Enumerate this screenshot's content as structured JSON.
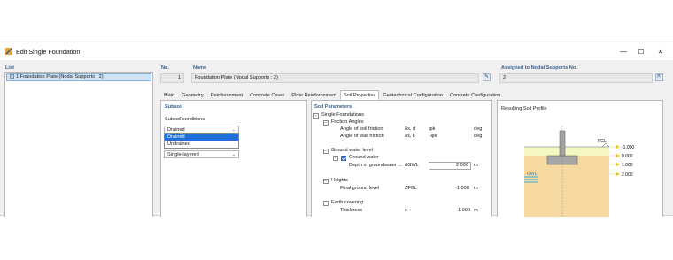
{
  "window": {
    "title": "Edit Single Foundation",
    "controls": {
      "minimize": "—",
      "maximize": "☐",
      "close": "✕"
    }
  },
  "list": {
    "header": "List",
    "items": [
      {
        "label": "1  Foundation Plate (Nodal Supports : 2)"
      }
    ]
  },
  "header": {
    "no_label": "No.",
    "no_value": "1",
    "name_label": "Name",
    "name_value": "Foundation Plate (Nodal Supports : 2)",
    "assigned_label": "Assigned to Nodal Supports No.",
    "assigned_value": "2"
  },
  "tabs": [
    "Main",
    "Geometry",
    "Reinforcement",
    "Concrete Cover",
    "Plate Reinforcement",
    "Soil Properties",
    "Geotechnical Configuration",
    "Concrete Configuration"
  ],
  "active_tab": "Soil Properties",
  "subsoil": {
    "header": "Subsoil",
    "conditions_label": "Subsoil conditions",
    "selected": "Drained",
    "options": [
      "Drained",
      "Undrained"
    ],
    "layering_value": "Single-layered"
  },
  "soil_params": {
    "header": "Soil Parameters",
    "root": "Single Foundations",
    "friction_group": "Friction Angles",
    "rows_friction": [
      {
        "label": "Angle of soil friction",
        "symbol": "δs, d",
        "value": "φk",
        "unit": "deg"
      },
      {
        "label": "Angle of wall friction",
        "symbol": "δs, k",
        "value": "-φk",
        "unit": "deg"
      }
    ],
    "gw_group": "Ground water level",
    "gw_check": "Ground water",
    "gw_depth": {
      "label": "Depth of groundwater ...",
      "symbol": "dGWL",
      "value": "2.000",
      "unit": "m"
    },
    "heights_group": "Heights",
    "final_level": {
      "label": "Final ground level",
      "symbol": "ZFGL",
      "value": "-1.000",
      "unit": "m"
    },
    "earth_group": "Earth covering",
    "thickness": {
      "label": "Thickness",
      "symbol": "c",
      "value": "1.000",
      "unit": "m"
    }
  },
  "profile": {
    "header": "Resulting Soil Profile",
    "fgl": "FGL",
    "gwl": "GWL",
    "levels": [
      "-1.000",
      "0.000",
      "1.000",
      "2.000"
    ],
    "colors": {
      "soil": "#f5d9a0",
      "cover": "#f4f7c2",
      "water": "#3ba7d8",
      "concrete": "#a6a6a6",
      "marker": "#f0c419"
    }
  }
}
